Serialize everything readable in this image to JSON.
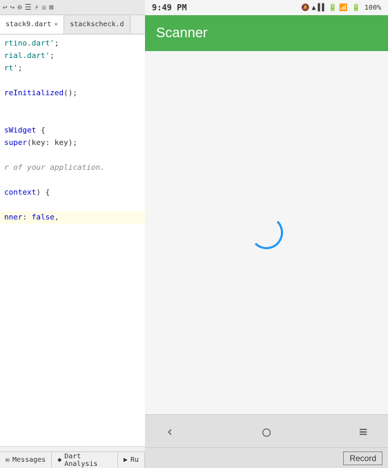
{
  "toolbar": {
    "icons": [
      "↩",
      "↪",
      "⊖",
      "⊕",
      "⚡",
      "□",
      "⊠"
    ]
  },
  "editor": {
    "tabs": [
      {
        "label": "stack9.dart",
        "active": true
      },
      {
        "label": "stackscheck.d",
        "active": false
      }
    ],
    "code_lines": [
      {
        "text": "rtino.dart';",
        "color": "normal",
        "highlighted": false
      },
      {
        "text": "rial.dart';",
        "color": "normal",
        "highlighted": false
      },
      {
        "text": "rt';",
        "color": "normal",
        "highlighted": false
      },
      {
        "text": "",
        "highlighted": false
      },
      {
        "text": "reInitialized();",
        "color": "blue",
        "highlighted": false
      },
      {
        "text": "",
        "highlighted": false
      },
      {
        "text": "",
        "highlighted": false
      },
      {
        "text": "sWidget {",
        "color": "normal",
        "highlighted": false
      },
      {
        "text": "super(key: key);",
        "color": "normal",
        "highlighted": false
      },
      {
        "text": "",
        "highlighted": false
      },
      {
        "text": "r of your application.",
        "color": "gray",
        "highlighted": false
      },
      {
        "text": "",
        "highlighted": false
      },
      {
        "text": "context) {",
        "color": "normal",
        "highlighted": false
      },
      {
        "text": "",
        "highlighted": false
      },
      {
        "text": "nner: false,",
        "color": "normal",
        "highlighted": true
      }
    ]
  },
  "bottom_tabs": [
    {
      "label": "Messages",
      "icon": "✉"
    },
    {
      "label": "Dart Analysis",
      "icon": "◆"
    },
    {
      "label": "Ru",
      "icon": "▶"
    }
  ],
  "phone": {
    "status_bar": {
      "time": "9:49 PM",
      "icons": "📶 🔋 100%"
    },
    "app_title": "Scanner",
    "nav": {
      "back_icon": "‹",
      "home_icon": "○",
      "menu_icon": "≡"
    },
    "record_button": "Record"
  }
}
